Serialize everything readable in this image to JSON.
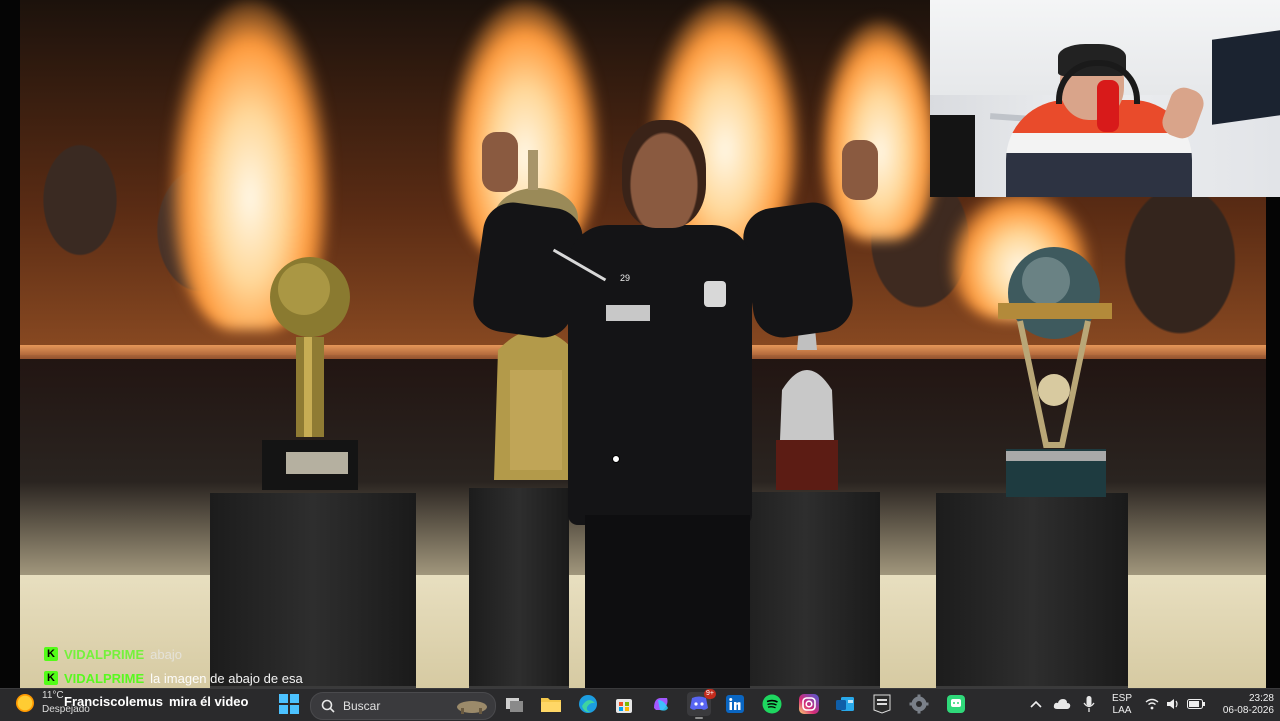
{
  "chat": {
    "messages": [
      {
        "user": "VIDALPRIME",
        "text": "abajo",
        "badge": "K"
      },
      {
        "user": "VIDALPRIME",
        "text": "la imagen de abajo de esa",
        "badge": "K"
      },
      {
        "user": "Franciscolemus",
        "text": "mira él video",
        "badge": "K"
      }
    ]
  },
  "player": {
    "shirt_number": "29"
  },
  "taskbar": {
    "weather": {
      "temp": "11°C",
      "condition": "Despejado"
    },
    "search_placeholder": "Buscar",
    "discord_badge": "9+",
    "language": {
      "code": "ESP",
      "layout": "LAA"
    },
    "clock": {
      "time": "23:28",
      "date": "06-08-2026"
    },
    "apps": [
      "windows-start-icon",
      "search-icon",
      "task-view-icon",
      "file-explorer-icon",
      "edge-icon",
      "microsoft-store-icon",
      "copilot-icon",
      "discord-icon",
      "linkedin-icon",
      "spotify-icon",
      "instagram-icon",
      "outlook-icon",
      "epic-games-icon",
      "settings-icon",
      "chat-app-icon"
    ]
  },
  "colors": {
    "kick_green": "#53fc18",
    "taskbar_bg": "#2a2a2c"
  }
}
